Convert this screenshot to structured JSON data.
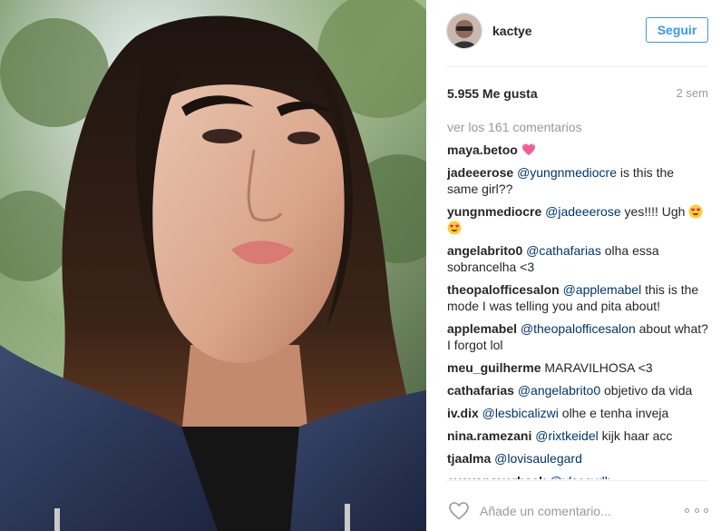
{
  "post": {
    "username": "kactye",
    "follow_label": "Seguir",
    "likes": "5.955 Me gusta",
    "time_ago": "2 sem",
    "view_all": "ver los 161 comentarios",
    "comments": [
      {
        "user": "maya.betoo",
        "parts": [],
        "emoji": [
          "sparkling-heart"
        ]
      },
      {
        "user": "jadeeerose",
        "parts": [
          {
            "t": "@yungnmediocre",
            "m": true
          },
          {
            "t": " is this the same girl??"
          }
        ]
      },
      {
        "user": "yungnmediocre",
        "parts": [
          {
            "t": "@jadeeerose",
            "m": true
          },
          {
            "t": " yes!!!! Ugh "
          }
        ],
        "emoji": [
          "heart-eyes",
          "heart-eyes"
        ]
      },
      {
        "user": "angelabrito0",
        "parts": [
          {
            "t": "@cathafarias",
            "m": true
          },
          {
            "t": " olha essa sobrancelha <3"
          }
        ]
      },
      {
        "user": "theopalofficesalon",
        "parts": [
          {
            "t": "@applemabel",
            "m": true
          },
          {
            "t": " this is the mode I was telling you and pita about!"
          }
        ]
      },
      {
        "user": "applemabel",
        "parts": [
          {
            "t": "@theopalofficesalon",
            "m": true
          },
          {
            "t": " about what? I forgot lol"
          }
        ]
      },
      {
        "user": "meu_guilherme",
        "parts": [
          {
            "t": "MARAVILHOSA <3"
          }
        ]
      },
      {
        "user": "cathafarias",
        "parts": [
          {
            "t": "@angelabrito0",
            "m": true
          },
          {
            "t": " objetivo da vida"
          }
        ]
      },
      {
        "user": "iv.dix",
        "parts": [
          {
            "t": "@lesbicalizwi",
            "m": true
          },
          {
            "t": " olhe e tenha inveja"
          }
        ]
      },
      {
        "user": "nina.ramezani",
        "parts": [
          {
            "t": "@rixtkeidel",
            "m": true
          },
          {
            "t": " kijk haar acc"
          }
        ]
      },
      {
        "user": "tjaalma",
        "parts": [
          {
            "t": "@lovisaulegard",
            "m": true
          }
        ]
      },
      {
        "user": "evavanoverbeek",
        "parts": [
          {
            "t": "@ylsesydh",
            "m": true
          }
        ]
      }
    ],
    "comment_placeholder": "Añade un comentario..."
  },
  "colors": {
    "accent": "#3897f0",
    "mention": "#003569",
    "muted": "#999999"
  },
  "icons": {
    "like": "heart-outline-icon",
    "more": "more-options-icon"
  }
}
